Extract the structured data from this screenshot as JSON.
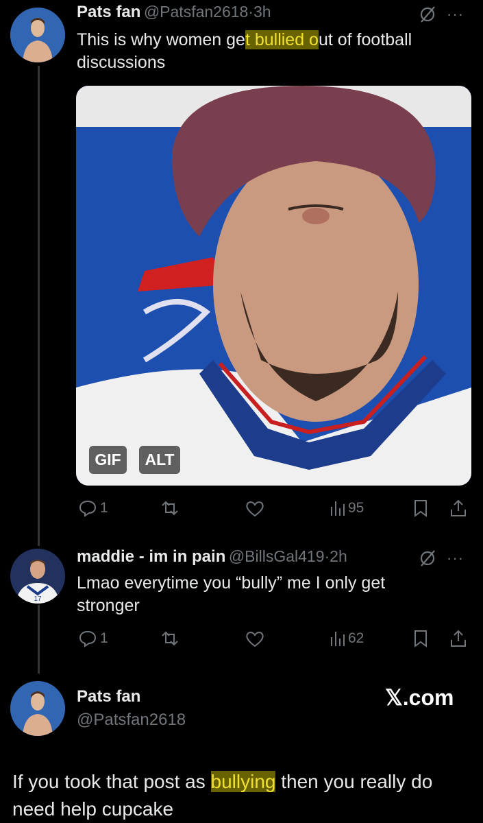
{
  "post1": {
    "name": "Pats fan",
    "handle": "@Patsfan2618",
    "time": "3h",
    "text_parts": [
      "This is why women ge",
      "t bullied o",
      "ut of football discussions"
    ],
    "media_badges": [
      "GIF",
      "ALT"
    ],
    "replies": "1",
    "views": "95"
  },
  "post2": {
    "name": "maddie - im in pain",
    "handle": "@BillsGal419",
    "time": "2h",
    "text": "Lmao everytime you “bully” me I only get stronger",
    "replies": "1",
    "views": "62"
  },
  "post3": {
    "name": "Pats fan",
    "handle": "@Patsfan2618",
    "brand": "𝕏.com",
    "text_parts": [
      "If you took that post as ",
      "bullying",
      " then you really do need help cupcake"
    ]
  },
  "colors": {
    "background": "#000000",
    "text": "#e7e9ea",
    "muted": "#71767b",
    "highlight": "#f0e030"
  }
}
